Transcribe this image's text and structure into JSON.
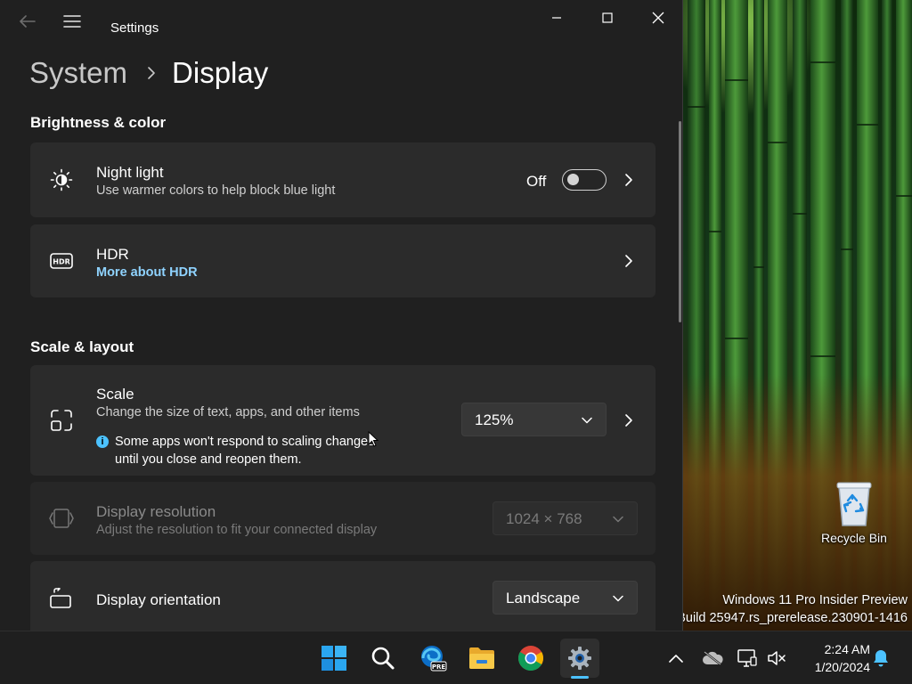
{
  "window": {
    "app_title": "Settings",
    "breadcrumb": {
      "parent": "System",
      "separator": "›",
      "current": "Display"
    }
  },
  "sections": {
    "brightness": "Brightness & color",
    "scale_layout": "Scale & layout"
  },
  "night_light": {
    "title": "Night light",
    "description": "Use warmer colors to help block blue light",
    "state_label": "Off",
    "enabled": false
  },
  "hdr": {
    "title": "HDR",
    "link": "More about HDR"
  },
  "scale": {
    "title": "Scale",
    "description": "Change the size of text, apps, and other items",
    "value": "125%",
    "info_line1": "Some apps won't respond to scaling changes",
    "info_line2": "until you close and reopen them."
  },
  "resolution": {
    "title": "Display resolution",
    "description": "Adjust the resolution to fit your connected display",
    "value": "1024 × 768"
  },
  "orientation": {
    "title": "Display orientation",
    "value": "Landscape"
  },
  "desktop": {
    "recycle_bin": "Recycle Bin",
    "watermark_line1": "Windows 11 Pro Insider Preview",
    "watermark_line2": "Build 25947.rs_prerelease.230901-1416"
  },
  "taskbar": {
    "apps": [
      "start-icon",
      "search-icon",
      "edge-beta-icon",
      "file-explorer-icon",
      "chrome-icon",
      "settings-icon"
    ],
    "time": "2:24 AM",
    "date": "1/20/2024"
  },
  "colors": {
    "accent": "#4cc2ff",
    "link": "#8fd3ff",
    "window_bg": "#202020",
    "card_bg": "#2b2b2b",
    "taskbar_bg": "#1f1f1f"
  }
}
